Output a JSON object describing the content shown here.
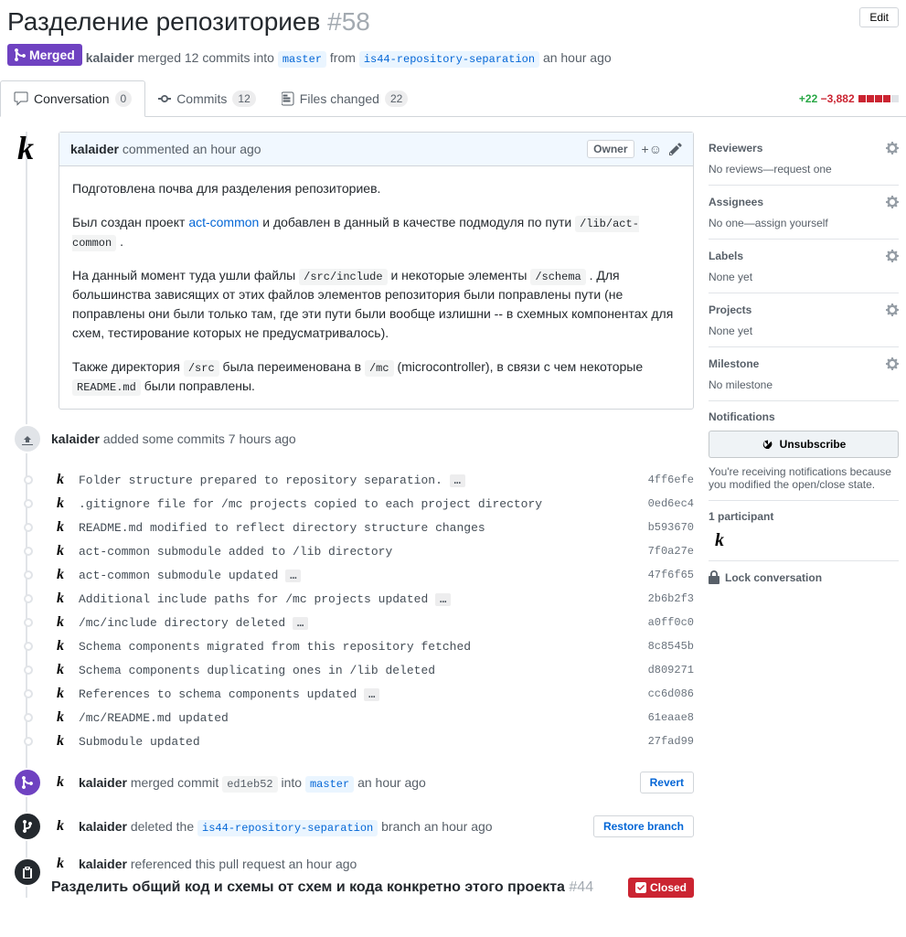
{
  "header": {
    "title": "Разделение репозиториев",
    "number": "#58",
    "edit": "Edit",
    "state": "Merged",
    "author": "kalaider",
    "merged_text_1": "merged 12 commits into",
    "base_branch": "master",
    "from": "from",
    "head_branch": "is44-repository-separation",
    "time": "an hour ago"
  },
  "tabs": {
    "conversation": {
      "label": "Conversation",
      "count": "0"
    },
    "commits": {
      "label": "Commits",
      "count": "12"
    },
    "files": {
      "label": "Files changed",
      "count": "22"
    }
  },
  "diffstat": {
    "add": "+22",
    "del": "−3,882"
  },
  "comment": {
    "author": "kalaider",
    "action": "commented an hour ago",
    "owner": "Owner",
    "p1": "Подготовлена почва для разделения репозиториев.",
    "p2a": "Был создан проект ",
    "p2_link": "act-common",
    "p2b": " и добавлен в данный в качестве подмодуля по пути ",
    "p2_code": "/lib/act-common",
    "p2c": " .",
    "p3a": "На данный момент туда ушли файлы ",
    "p3_code1": "/src/include",
    "p3b": " и некоторые элементы ",
    "p3_code2": "/schema",
    "p3c": " . Для большинства зависящих от этих файлов элементов репозитория были поправлены пути (не поправлены они были только там, где эти пути были вообще излишни -- в схемных компонентах для схем, тестирование которых не предусматривалось).",
    "p4a": "Также директория ",
    "p4_code1": "/src",
    "p4b": " была переименована в ",
    "p4_code2": "/mc",
    "p4c": " (microcontroller), в связи с чем некоторые ",
    "p4_code3": "README.md",
    "p4d": " были поправлены."
  },
  "added_commits": {
    "author": "kalaider",
    "text": "added some commits 7 hours ago"
  },
  "commits": [
    {
      "msg": "Folder structure prepared to repository separation.",
      "sha": "4ff6efe",
      "ell": true
    },
    {
      "msg": ".gitignore file for /mc projects copied to each project directory",
      "sha": "0ed6ec4",
      "ell": false
    },
    {
      "msg": "README.md modified to reflect directory structure changes",
      "sha": "b593670",
      "ell": false
    },
    {
      "msg": "act-common submodule added to /lib directory",
      "sha": "7f0a27e",
      "ell": false
    },
    {
      "msg": "act-common submodule updated",
      "sha": "47f6f65",
      "ell": true
    },
    {
      "msg": "Additional include paths for /mc projects updated",
      "sha": "2b6b2f3",
      "ell": true
    },
    {
      "msg": "/mc/include directory deleted",
      "sha": "a0ff0c0",
      "ell": true
    },
    {
      "msg": "Schema components migrated from this repository fetched",
      "sha": "8c8545b",
      "ell": false
    },
    {
      "msg": "Schema components duplicating ones in /lib deleted",
      "sha": "d809271",
      "ell": false
    },
    {
      "msg": "References to schema components updated",
      "sha": "cc6d086",
      "ell": true
    },
    {
      "msg": "/mc/README.md updated",
      "sha": "61eaae8",
      "ell": false
    },
    {
      "msg": "Submodule updated",
      "sha": "27fad99",
      "ell": false
    }
  ],
  "merged_event": {
    "author": "kalaider",
    "a": "merged commit",
    "sha": "ed1eb52",
    "b": "into",
    "branch": "master",
    "time": "an hour ago",
    "revert": "Revert"
  },
  "deleted_event": {
    "author": "kalaider",
    "a": "deleted the",
    "branch": "is44-repository-separation",
    "b": "branch an hour ago",
    "restore": "Restore branch"
  },
  "ref_event": {
    "author": "kalaider",
    "a": "referenced this pull request an hour ago",
    "title": "Разделить общий код и схемы от схем и кода конкретно этого проекта",
    "number": "#44",
    "state": "Closed"
  },
  "sidebar": {
    "reviewers": {
      "title": "Reviewers",
      "body": "No reviews—request one"
    },
    "assignees": {
      "title": "Assignees",
      "body": "No one—",
      "self": "assign yourself"
    },
    "labels": {
      "title": "Labels",
      "body": "None yet"
    },
    "projects": {
      "title": "Projects",
      "body": "None yet"
    },
    "milestone": {
      "title": "Milestone",
      "body": "No milestone"
    },
    "notifications": {
      "title": "Notifications",
      "button": "Unsubscribe",
      "desc": "You're receiving notifications because you modified the open/close state."
    },
    "participants": {
      "title": "1 participant"
    },
    "lock": "Lock conversation"
  }
}
